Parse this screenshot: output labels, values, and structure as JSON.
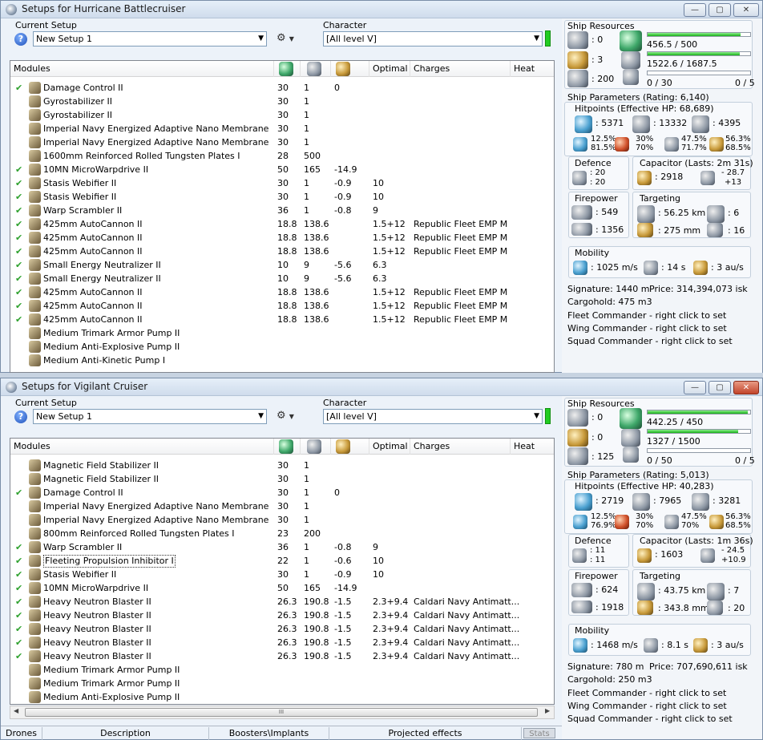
{
  "window1": {
    "title": "Setups for Hurricane Battlecruiser",
    "current_setup_label": "Current Setup",
    "setup_value": "New Setup 1",
    "character_label": "Character",
    "character_value": "[All level V]",
    "headers": {
      "modules": "Modules",
      "optimal": "Optimal",
      "charges": "Charges",
      "heat": "Heat"
    },
    "rows": [
      {
        "chk": "✔",
        "name": "Damage Control II",
        "c1": "30",
        "c2": "1",
        "c3": "0",
        "c4": "",
        "c5": ""
      },
      {
        "chk": "",
        "name": "Gyrostabilizer II",
        "c1": "30",
        "c2": "1",
        "c3": "",
        "c4": "",
        "c5": ""
      },
      {
        "chk": "",
        "name": "Gyrostabilizer II",
        "c1": "30",
        "c2": "1",
        "c3": "",
        "c4": "",
        "c5": ""
      },
      {
        "chk": "",
        "name": "Imperial Navy Energized Adaptive Nano Membrane",
        "c1": "30",
        "c2": "1",
        "c3": "",
        "c4": "",
        "c5": ""
      },
      {
        "chk": "",
        "name": "Imperial Navy Energized Adaptive Nano Membrane",
        "c1": "30",
        "c2": "1",
        "c3": "",
        "c4": "",
        "c5": ""
      },
      {
        "chk": "",
        "name": "1600mm Reinforced Rolled Tungsten Plates I",
        "c1": "28",
        "c2": "500",
        "c3": "",
        "c4": "",
        "c5": ""
      },
      {
        "chk": "✔",
        "name": "10MN MicroWarpdrive II",
        "c1": "50",
        "c2": "165",
        "c3": "-14.9",
        "c4": "",
        "c5": ""
      },
      {
        "chk": "✔",
        "name": "Stasis Webifier II",
        "c1": "30",
        "c2": "1",
        "c3": "-0.9",
        "c4": "10",
        "c5": ""
      },
      {
        "chk": "✔",
        "name": "Stasis Webifier II",
        "c1": "30",
        "c2": "1",
        "c3": "-0.9",
        "c4": "10",
        "c5": ""
      },
      {
        "chk": "✔",
        "name": "Warp Scrambler II",
        "c1": "36",
        "c2": "1",
        "c3": "-0.8",
        "c4": "9",
        "c5": ""
      },
      {
        "chk": "✔",
        "name": "425mm AutoCannon II",
        "c1": "18.8",
        "c2": "138.6",
        "c3": "",
        "c4": "1.5+12",
        "c5": "Republic Fleet EMP M"
      },
      {
        "chk": "✔",
        "name": "425mm AutoCannon II",
        "c1": "18.8",
        "c2": "138.6",
        "c3": "",
        "c4": "1.5+12",
        "c5": "Republic Fleet EMP M"
      },
      {
        "chk": "✔",
        "name": "425mm AutoCannon II",
        "c1": "18.8",
        "c2": "138.6",
        "c3": "",
        "c4": "1.5+12",
        "c5": "Republic Fleet EMP M"
      },
      {
        "chk": "✔",
        "name": "Small Energy Neutralizer II",
        "c1": "10",
        "c2": "9",
        "c3": "-5.6",
        "c4": "6.3",
        "c5": ""
      },
      {
        "chk": "✔",
        "name": "Small Energy Neutralizer II",
        "c1": "10",
        "c2": "9",
        "c3": "-5.6",
        "c4": "6.3",
        "c5": ""
      },
      {
        "chk": "✔",
        "name": "425mm AutoCannon II",
        "c1": "18.8",
        "c2": "138.6",
        "c3": "",
        "c4": "1.5+12",
        "c5": "Republic Fleet EMP M"
      },
      {
        "chk": "✔",
        "name": "425mm AutoCannon II",
        "c1": "18.8",
        "c2": "138.6",
        "c3": "",
        "c4": "1.5+12",
        "c5": "Republic Fleet EMP M"
      },
      {
        "chk": "✔",
        "name": "425mm AutoCannon II",
        "c1": "18.8",
        "c2": "138.6",
        "c3": "",
        "c4": "1.5+12",
        "c5": "Republic Fleet EMP M"
      },
      {
        "chk": "",
        "name": "Medium Trimark Armor Pump II",
        "c1": "",
        "c2": "",
        "c3": "",
        "c4": "",
        "c5": ""
      },
      {
        "chk": "",
        "name": "Medium Anti-Explosive Pump II",
        "c1": "",
        "c2": "",
        "c3": "",
        "c4": "",
        "c5": ""
      },
      {
        "chk": "",
        "name": "Medium Anti-Kinetic Pump I",
        "c1": "",
        "c2": "",
        "c3": "",
        "c4": "",
        "c5": ""
      }
    ],
    "resources": {
      "title": "Ship Resources",
      "hi": ": 0",
      "med": ": 3",
      "low": ": 200",
      "cpu": "456.5 / 500",
      "cpu_fill": 0.91,
      "pg": "1522.6 / 1687.5",
      "pg_fill": 0.9,
      "drone_bay": "0 / 30",
      "drones": "0 / 5",
      "drone_fill": 0.0
    },
    "params": {
      "title": "Ship Parameters (Rating: 6,140)",
      "hp_title": "Hitpoints (Effective HP: 68,689)",
      "shield": ": 5371",
      "armor": ": 13332",
      "hull": ": 4395",
      "em_s": "12.5%",
      "em_a": "81.5%",
      "th_s": "30%",
      "th_a": "70%",
      "ki_s": "47.5%",
      "ki_a": "71.7%",
      "ex_s": "56.3%",
      "ex_a": "68.5%",
      "defence_title": "Defence",
      "def1": ": 20",
      "def2": ": 20",
      "cap_title": "Capacitor (Lasts: 2m 31s)",
      "cap": ": 2918",
      "cap_d1": "- 28.7",
      "cap_d2": "+13",
      "fire_title": "Firepower",
      "fire1": ": 549",
      "fire2": ": 1356",
      "targ_title": "Targeting",
      "range": ": 56.25 km",
      "targets": ": 6",
      "scan": ": 275 mm",
      "sensor": ": 16",
      "mob_title": "Mobility",
      "speed": ": 1025 m/s",
      "align": ": 14 s",
      "warp": ": 3 au/s",
      "signature": "Signature: 1440 m",
      "price": "Price: 314,394,073 isk",
      "cargo": "Cargohold: 475 m3",
      "fleet": "Fleet Commander - right click to set",
      "wing": "Wing Commander - right click to set",
      "squad": "Squad Commander - right click to set"
    }
  },
  "window2": {
    "title": "Setups for Vigilant Cruiser",
    "current_setup_label": "Current Setup",
    "setup_value": "New Setup 1",
    "character_label": "Character",
    "character_value": "[All level V]",
    "headers": {
      "modules": "Modules",
      "optimal": "Optimal",
      "charges": "Charges",
      "heat": "Heat"
    },
    "rows": [
      {
        "chk": "",
        "name": "Magnetic Field Stabilizer II",
        "c1": "30",
        "c2": "1",
        "c3": "",
        "c4": "",
        "c5": ""
      },
      {
        "chk": "",
        "name": "Magnetic Field Stabilizer II",
        "c1": "30",
        "c2": "1",
        "c3": "",
        "c4": "",
        "c5": ""
      },
      {
        "chk": "✔",
        "name": "Damage Control II",
        "c1": "30",
        "c2": "1",
        "c3": "0",
        "c4": "",
        "c5": ""
      },
      {
        "chk": "",
        "name": "Imperial Navy Energized Adaptive Nano Membrane",
        "c1": "30",
        "c2": "1",
        "c3": "",
        "c4": "",
        "c5": ""
      },
      {
        "chk": "",
        "name": "Imperial Navy Energized Adaptive Nano Membrane",
        "c1": "30",
        "c2": "1",
        "c3": "",
        "c4": "",
        "c5": ""
      },
      {
        "chk": "",
        "name": "800mm Reinforced Rolled Tungsten Plates I",
        "c1": "23",
        "c2": "200",
        "c3": "",
        "c4": "",
        "c5": ""
      },
      {
        "chk": "✔",
        "name": "Warp Scrambler II",
        "c1": "36",
        "c2": "1",
        "c3": "-0.8",
        "c4": "9",
        "c5": ""
      },
      {
        "chk": "✔",
        "name": "Fleeting Propulsion Inhibitor I",
        "c1": "22",
        "c2": "1",
        "c3": "-0.6",
        "c4": "10",
        "c5": ""
      },
      {
        "chk": "✔",
        "name": "Stasis Webifier II",
        "c1": "30",
        "c2": "1",
        "c3": "-0.9",
        "c4": "10",
        "c5": ""
      },
      {
        "chk": "✔",
        "name": "10MN MicroWarpdrive II",
        "c1": "50",
        "c2": "165",
        "c3": "-14.9",
        "c4": "",
        "c5": ""
      },
      {
        "chk": "✔",
        "name": "Heavy Neutron Blaster II",
        "c1": "26.3",
        "c2": "190.8",
        "c3": "-1.5",
        "c4": "2.3+9.4",
        "c5": "Caldari Navy Antimatt..."
      },
      {
        "chk": "✔",
        "name": "Heavy Neutron Blaster II",
        "c1": "26.3",
        "c2": "190.8",
        "c3": "-1.5",
        "c4": "2.3+9.4",
        "c5": "Caldari Navy Antimatt..."
      },
      {
        "chk": "✔",
        "name": "Heavy Neutron Blaster II",
        "c1": "26.3",
        "c2": "190.8",
        "c3": "-1.5",
        "c4": "2.3+9.4",
        "c5": "Caldari Navy Antimatt..."
      },
      {
        "chk": "✔",
        "name": "Heavy Neutron Blaster II",
        "c1": "26.3",
        "c2": "190.8",
        "c3": "-1.5",
        "c4": "2.3+9.4",
        "c5": "Caldari Navy Antimatt..."
      },
      {
        "chk": "✔",
        "name": "Heavy Neutron Blaster II",
        "c1": "26.3",
        "c2": "190.8",
        "c3": "-1.5",
        "c4": "2.3+9.4",
        "c5": "Caldari Navy Antimatt..."
      },
      {
        "chk": "",
        "name": "Medium Trimark Armor Pump II",
        "c1": "",
        "c2": "",
        "c3": "",
        "c4": "",
        "c5": ""
      },
      {
        "chk": "",
        "name": "Medium Trimark Armor Pump II",
        "c1": "",
        "c2": "",
        "c3": "",
        "c4": "",
        "c5": ""
      },
      {
        "chk": "",
        "name": "Medium Anti-Explosive Pump II",
        "c1": "",
        "c2": "",
        "c3": "",
        "c4": "",
        "c5": ""
      }
    ],
    "resources": {
      "title": "Ship Resources",
      "hi": ": 0",
      "med": ": 0",
      "low": ": 125",
      "cpu": "442.25 / 450",
      "cpu_fill": 0.98,
      "pg": "1327 / 1500",
      "pg_fill": 0.88,
      "drone_bay": "0 / 50",
      "drones": "0 / 5",
      "drone_fill": 0.0
    },
    "params": {
      "title": "Ship Parameters (Rating: 5,013)",
      "hp_title": "Hitpoints (Effective HP: 40,283)",
      "shield": ": 2719",
      "armor": ": 7965",
      "hull": ": 3281",
      "em_s": "12.5%",
      "em_a": "76.9%",
      "th_s": "30%",
      "th_a": "70%",
      "ki_s": "47.5%",
      "ki_a": "70%",
      "ex_s": "56.3%",
      "ex_a": "68.5%",
      "defence_title": "Defence",
      "def1": ": 11",
      "def2": ": 11",
      "cap_title": "Capacitor (Lasts: 1m 36s)",
      "cap": ": 1603",
      "cap_d1": "- 24.5",
      "cap_d2": "+10.9",
      "fire_title": "Firepower",
      "fire1": ": 624",
      "fire2": ": 1918",
      "targ_title": "Targeting",
      "range": ": 43.75 km",
      "targets": ": 7",
      "scan": ": 343.8 mm",
      "sensor": ": 20",
      "mob_title": "Mobility",
      "speed": ": 1468 m/s",
      "align": ": 8.1 s",
      "warp": ": 3 au/s",
      "signature": "Signature: 780 m",
      "price": "Price: 707,690,611 isk",
      "cargo": "Cargohold: 250 m3",
      "fleet": "Fleet Commander - right click to set",
      "wing": "Wing Commander - right click to set",
      "squad": "Squad Commander - right click to set"
    },
    "tabs": [
      "Drones",
      "Description",
      "Boosters\\Implants",
      "Projected effects",
      "Stats"
    ],
    "scroll_grip": "III"
  },
  "window_buttons": {
    "min": "—",
    "max": "▢",
    "close": "✕"
  },
  "colors": {
    "accent_green": "#22cc22",
    "close_red": "#c2442a"
  }
}
